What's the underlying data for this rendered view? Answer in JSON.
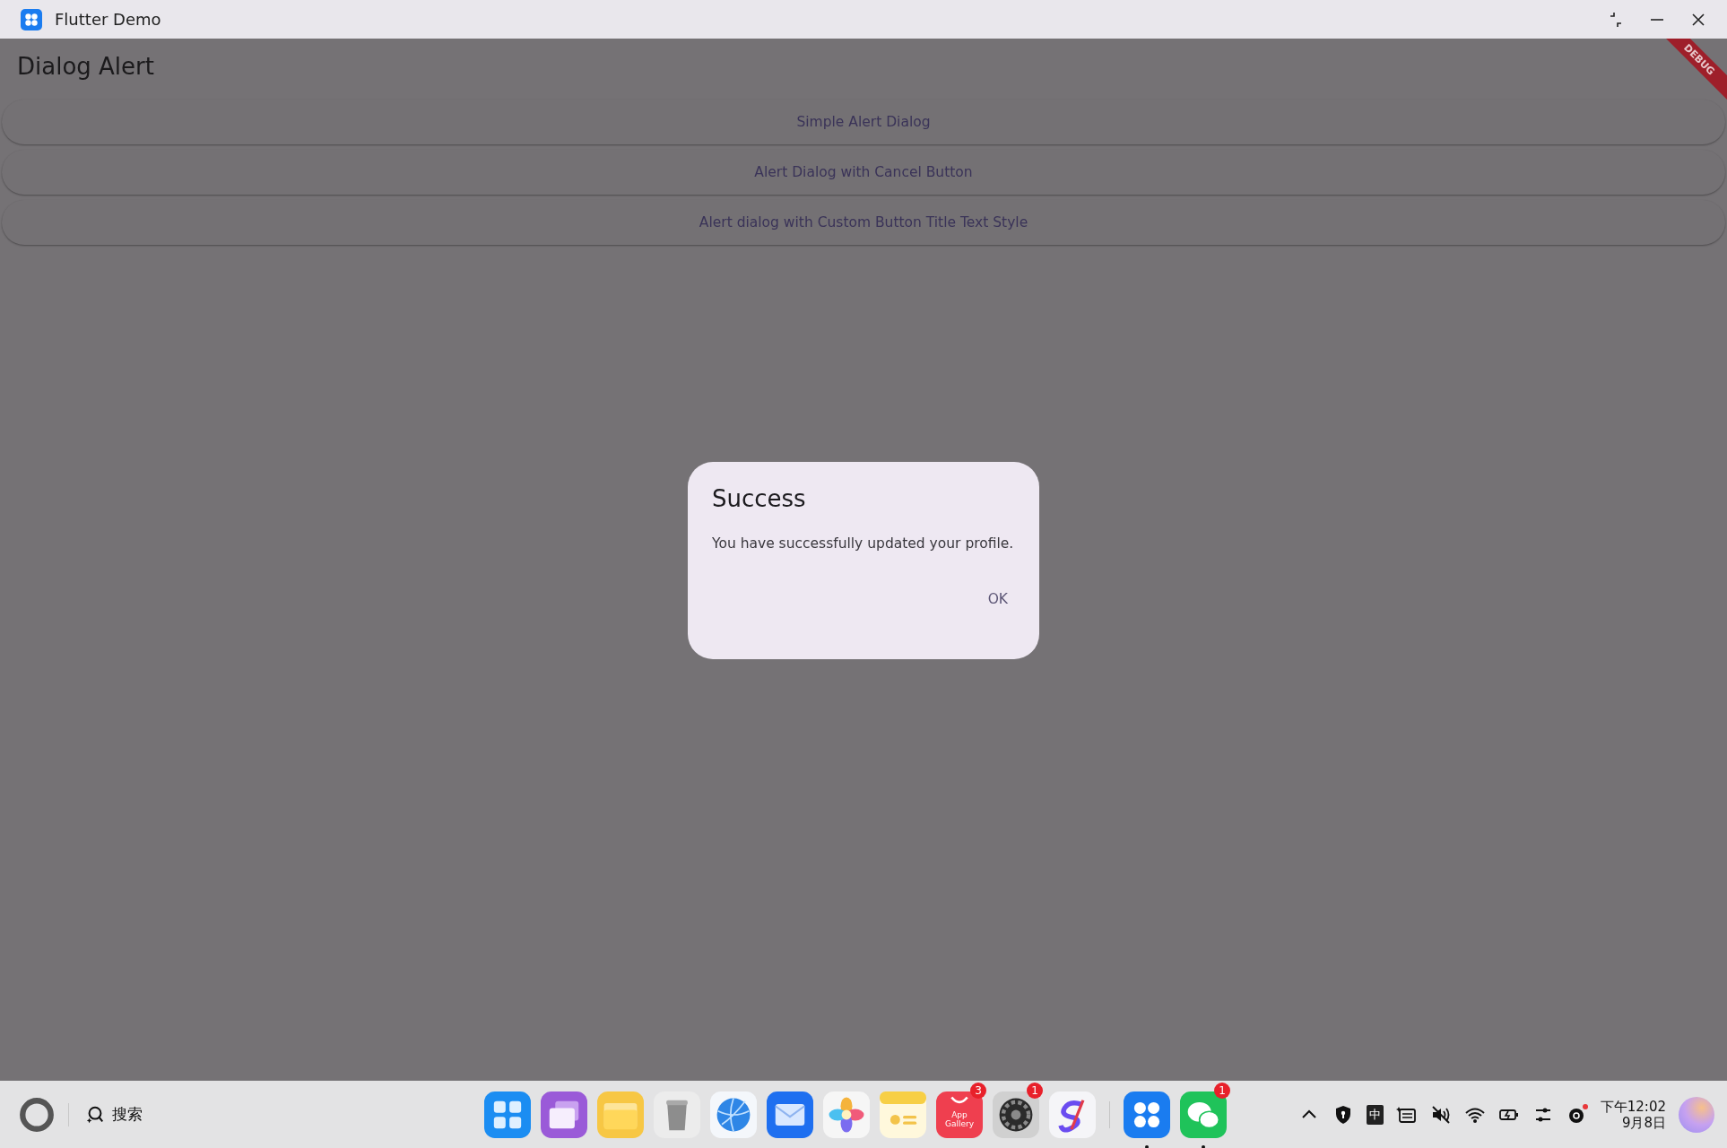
{
  "window": {
    "title": "Flutter Demo"
  },
  "app_bar": {
    "title": "Dialog Alert",
    "debug_banner": "DEBUG"
  },
  "buttons": [
    "Simple Alert Dialog",
    "Alert Dialog with Cancel Button",
    "Alert dialog with Custom Button Title Text Style"
  ],
  "dialog": {
    "title": "Success",
    "message": "You have successfully updated your profile.",
    "actions": [
      "OK"
    ]
  },
  "taskbar": {
    "search": "搜索",
    "dock": [
      {
        "kind": "launcher",
        "running": false
      },
      {
        "kind": "windows",
        "running": false
      },
      {
        "kind": "folder",
        "running": false
      },
      {
        "kind": "trash",
        "running": false
      },
      {
        "kind": "globe",
        "running": false
      },
      {
        "kind": "mail",
        "running": false
      },
      {
        "kind": "photos",
        "running": false
      },
      {
        "kind": "notes",
        "running": false
      },
      {
        "kind": "store",
        "label": "App Gallery",
        "badge": "3",
        "running": false
      },
      {
        "kind": "gear",
        "badge": "1",
        "running": false
      },
      {
        "kind": "swirl",
        "running": false
      },
      {
        "kind": "divider"
      },
      {
        "kind": "flutter",
        "running": true
      },
      {
        "kind": "chat",
        "badge": "1",
        "running": true
      }
    ],
    "tray": [
      {
        "kind": "chevron"
      },
      {
        "kind": "shield"
      },
      {
        "kind": "ime",
        "label": "中"
      },
      {
        "kind": "keyboard"
      },
      {
        "kind": "mute"
      },
      {
        "kind": "wifi"
      },
      {
        "kind": "battery"
      },
      {
        "kind": "sliders"
      },
      {
        "kind": "at",
        "alert": true
      }
    ],
    "clock": {
      "time": "下午12:02",
      "date": "9月8日"
    }
  }
}
